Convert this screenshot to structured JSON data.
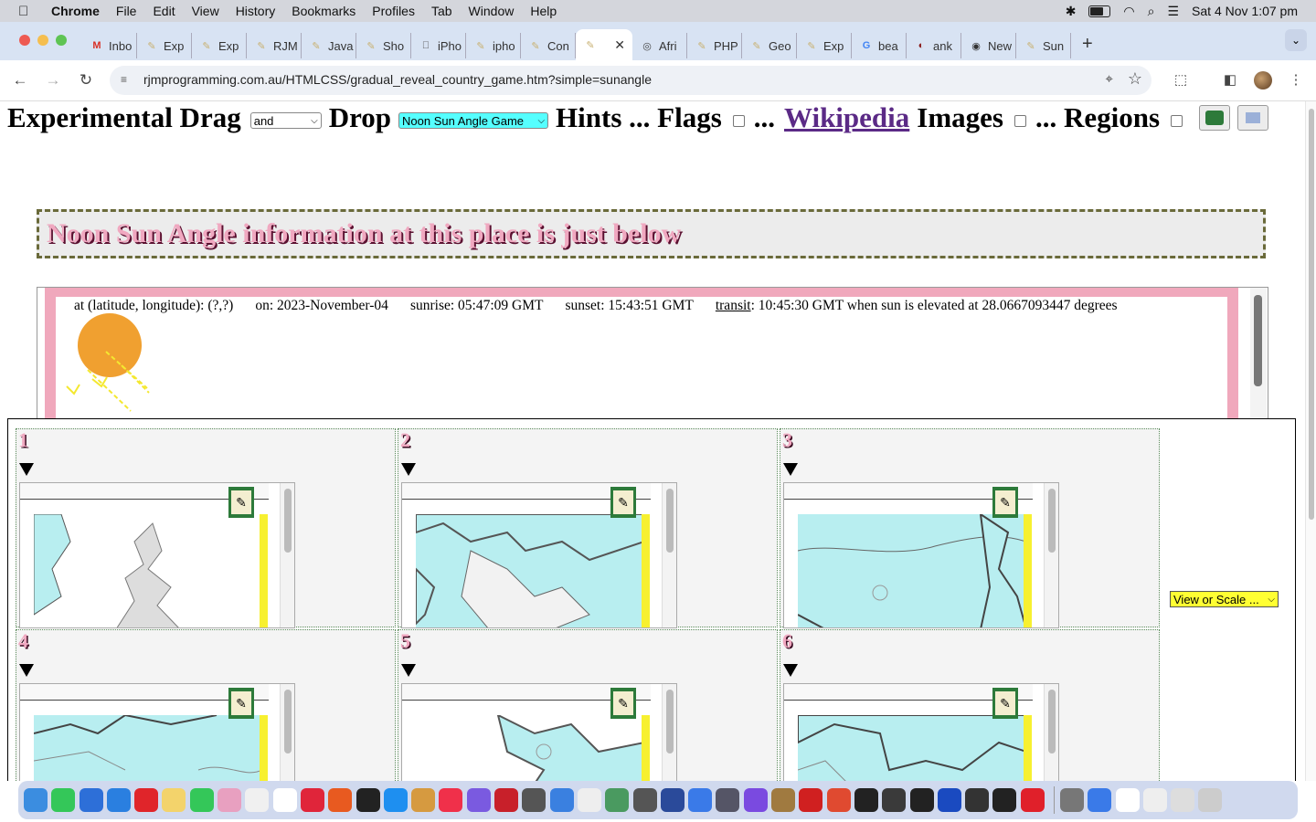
{
  "menubar": {
    "app": "Chrome",
    "items": [
      "File",
      "Edit",
      "View",
      "History",
      "Bookmarks",
      "Profiles",
      "Tab",
      "Window",
      "Help"
    ],
    "clock": "Sat 4 Nov  1:07 pm"
  },
  "tabs": [
    {
      "label": "Inbo",
      "icon": "gmail-icon",
      "color": "#d93025"
    },
    {
      "label": "Exp",
      "icon": "pencil-icon",
      "color": "#c8b070"
    },
    {
      "label": "Exp",
      "icon": "pencil-icon",
      "color": "#c8b070"
    },
    {
      "label": "RJM",
      "icon": "pencil-icon",
      "color": "#c8b070"
    },
    {
      "label": "Java",
      "icon": "pencil-icon",
      "color": "#c8b070"
    },
    {
      "label": "Sho",
      "icon": "pencil-icon",
      "color": "#c8b070"
    },
    {
      "label": "iPho",
      "icon": "apple-icon",
      "color": "#555"
    },
    {
      "label": "ipho",
      "icon": "pencil-icon",
      "color": "#c8b070"
    },
    {
      "label": "Con",
      "icon": "pencil-icon",
      "color": "#c8b070"
    },
    {
      "label": "",
      "icon": "pencil-icon",
      "color": "#c8b070",
      "active": true
    },
    {
      "label": "Afri",
      "icon": "globe-icon",
      "color": "#444"
    },
    {
      "label": "PHP",
      "icon": "pencil-icon",
      "color": "#c8b070"
    },
    {
      "label": "Geo",
      "icon": "pencil-icon",
      "color": "#c8b070"
    },
    {
      "label": "Exp",
      "icon": "pencil-icon",
      "color": "#c8b070"
    },
    {
      "label": "bea",
      "icon": "google-icon",
      "color": "#4285f4"
    },
    {
      "label": "ank",
      "icon": "mask-icon",
      "color": "#8a1a1a"
    },
    {
      "label": "New",
      "icon": "chrome-icon",
      "color": "#333"
    },
    {
      "label": "Sun",
      "icon": "pencil-icon",
      "color": "#c8b070"
    }
  ],
  "toolbar": {
    "url": "rjmprogramming.com.au/HTMLCSS/gradual_reveal_country_game.htm?simple=sunangle"
  },
  "page": {
    "heading": {
      "part1": "Experimental Drag",
      "select1": "and",
      "part2": "Drop",
      "select2": "Noon Sun Angle Game",
      "part3": "Hints ... Flags",
      "part4": "...",
      "link": "Wikipedia",
      "part5": "Images",
      "part6": "... Regions"
    },
    "info_title": "Noon Sun Angle information at this place is just below",
    "sun": {
      "location": "at (latitude, longitude): (?,?)",
      "on": "on: 2023-November-04",
      "sunrise": "sunrise: 05:47:09 GMT",
      "sunset": "sunset: 15:43:51 GMT",
      "transit_link": "transit",
      "transit_rest": ": 10:45:30 GMT when sun is elevated at 28.0667093447 degrees"
    },
    "cells": [
      {
        "num": "1",
        "map": "philippines"
      },
      {
        "num": "2",
        "map": "greece"
      },
      {
        "num": "3",
        "map": "bulgaria"
      },
      {
        "num": "4",
        "map": "landmass-a"
      },
      {
        "num": "5",
        "map": "landmass-b"
      },
      {
        "num": "6",
        "map": "landmass-c"
      }
    ],
    "view_select": "View or Scale ..."
  },
  "colors": {
    "accent_pink": "#f0a8c0",
    "map_sea": "#b8eef0",
    "sun": "#f0a030"
  }
}
